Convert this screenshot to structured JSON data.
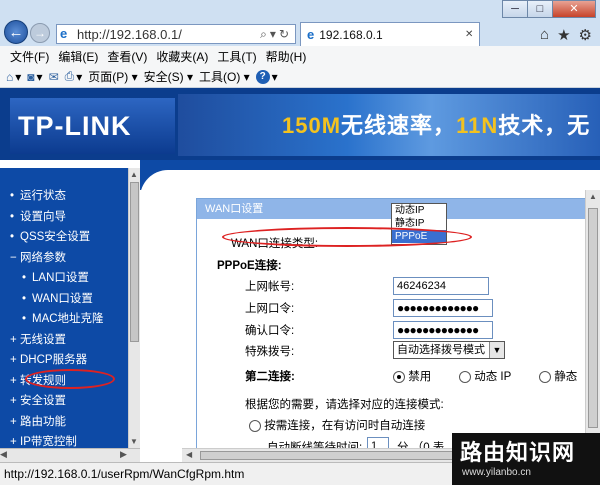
{
  "browser": {
    "address_url": "http://192.168.0.1/",
    "tab_title": "192.168.0.1",
    "window_buttons": [
      "─",
      "□",
      "✕"
    ],
    "nav_icons": [
      "back-arrow-icon",
      "forward-arrow-icon",
      "search-icon",
      "refresh-icon",
      "home-icon",
      "favorites-star-icon",
      "settings-gear-icon"
    ],
    "menu": [
      "文件(F)",
      "编辑(E)",
      "查看(V)",
      "收藏夹(A)",
      "工具(T)",
      "帮助(H)"
    ],
    "command_bar": [
      "页面(P) ▾",
      "安全(S) ▾",
      "工具(O) ▾"
    ],
    "status_url": "http://192.168.0.1/userRpm/WanCfgRpm.htm"
  },
  "banner": {
    "logo": "TP-LINK",
    "slogan_part1": "150M",
    "slogan_part2": "无线速率，",
    "slogan_part3": "11N",
    "slogan_part4": "技术，无"
  },
  "sidebar": {
    "items": [
      {
        "label": "运行状态",
        "sub": false
      },
      {
        "label": "设置向导",
        "sub": false
      },
      {
        "label": "QSS安全设置",
        "sub": false
      },
      {
        "label": "网络参数",
        "sub": false,
        "expanded": true
      },
      {
        "label": "LAN口设置",
        "sub": true
      },
      {
        "label": "WAN口设置",
        "sub": true,
        "active": true
      },
      {
        "label": "MAC地址克隆",
        "sub": true
      },
      {
        "label": "无线设置",
        "sub": false
      },
      {
        "label": "DHCP服务器",
        "sub": false
      },
      {
        "label": "转发规则",
        "sub": false
      },
      {
        "label": "安全设置",
        "sub": false
      },
      {
        "label": "路由功能",
        "sub": false
      },
      {
        "label": "IP带宽控制",
        "sub": false
      }
    ]
  },
  "form": {
    "header": "WAN口设置",
    "wan_type_label": "WAN口连接类型:",
    "wan_type_options": [
      "动态IP",
      "静态IP",
      "PPPoE"
    ],
    "wan_type_selected": "PPPoE",
    "pppoe_section": "PPPoE连接:",
    "account_label": "上网帐号:",
    "account_value": "46246234",
    "password_label": "上网口令:",
    "password_value": "●●●●●●●●●●●●●",
    "confirm_label": "确认口令:",
    "confirm_value": "●●●●●●●●●●●●●",
    "dial_label": "特殊拨号:",
    "dial_value": "自动选择拨号模式",
    "second_conn_label": "第二连接:",
    "second_conn_options": [
      "禁用",
      "动态 IP",
      "静态"
    ],
    "second_conn_selected": "禁用",
    "mode_hint": "根据您的需要，请选择对应的连接模式:",
    "mode_on_demand": "按需连接，在有访问时自动连接",
    "idle_label": "自动断线等待时间:",
    "idle_value": "1",
    "idle_unit": "分 （0 表"
  },
  "watermark": {
    "title": "路由知识网",
    "url": "www.yilanbo.cn"
  }
}
